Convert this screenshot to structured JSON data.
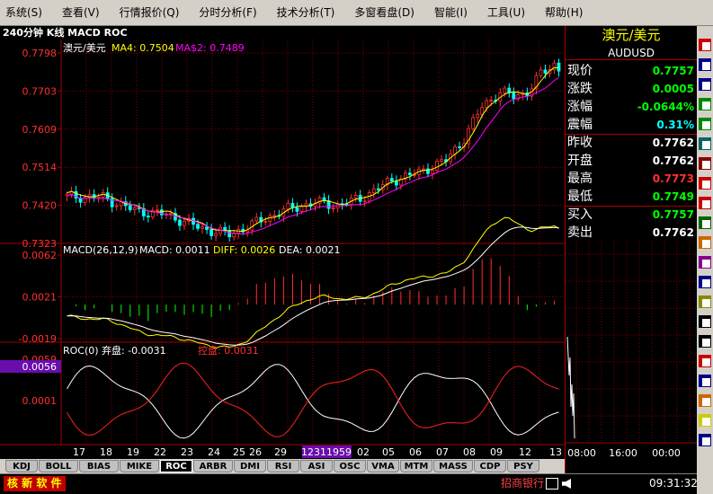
{
  "menu": [
    "系统(S)",
    "查看(V)",
    "行情报价(Q)",
    "分时分析(F)",
    "技术分析(T)",
    "多窗看盘(D)",
    "智能(I)",
    "工具(U)",
    "帮助(H)"
  ],
  "chart_title": "240分钟 K线 MACD ROC",
  "main_panel": {
    "symbol_label": "澳元/美元",
    "ma4_label": "MA4: 0.7504",
    "ma2_label": "MA$2: 0.7489",
    "y_ticks": [
      "0.7798",
      "0.7703",
      "0.7609",
      "0.7514",
      "0.7420",
      "0.7323"
    ]
  },
  "macd_panel": {
    "header": "MACD(26,12,9)",
    "macd_label": "MACD: 0.0011",
    "diff_label": "DIFF: 0.0026",
    "dea_label": "DEA: 0.0021",
    "y_ticks": [
      "0.0062",
      "0.0021",
      "-0.0019"
    ]
  },
  "roc_panel": {
    "header": "ROC(0)",
    "qi_label": "弃盘: -0.0031",
    "kong_label": "控盘: 0.0031",
    "y_ticks": [
      "0.0059",
      "0.0056",
      "0.0001"
    ]
  },
  "x_axis": [
    "17",
    "18",
    "19",
    "22",
    "23",
    "24",
    "25",
    "26",
    "29",
    "12311959",
    "02",
    "05",
    "06",
    "07",
    "08",
    "09",
    "12",
    "13"
  ],
  "tabs": [
    "KDJ",
    "BOLL",
    "BIAS",
    "MIKE",
    "ROC",
    "ARBR",
    "DMI",
    "RSI",
    "ASI",
    "OSC",
    "VMA",
    "MTM",
    "MASS",
    "CDP",
    "PSY"
  ],
  "active_tab": "ROC",
  "quote": {
    "name_cn": "澳元/美元",
    "code": "AUDUSD",
    "rows": [
      {
        "label": "现价",
        "value": "0.7757",
        "color": "#00ff00"
      },
      {
        "label": "涨跌",
        "value": "0.0005",
        "color": "#00ff00"
      },
      {
        "label": "涨幅",
        "value": "-0.0644%",
        "color": "#00ff00"
      },
      {
        "label": "震幅",
        "value": "0.31%",
        "color": "#00ffff"
      },
      {
        "label": "昨收",
        "value": "0.7762",
        "color": "#ffffff"
      },
      {
        "label": "开盘",
        "value": "0.7762",
        "color": "#ffffff"
      },
      {
        "label": "最高",
        "value": "0.7773",
        "color": "#ff3030"
      },
      {
        "label": "最低",
        "value": "0.7749",
        "color": "#00ff00"
      },
      {
        "label": "买入",
        "value": "0.7757",
        "color": "#00ff00"
      },
      {
        "label": "卖出",
        "value": "0.7762",
        "color": "#ffffff"
      }
    ]
  },
  "intraday_times": [
    "08:00",
    "16:00",
    "00:00"
  ],
  "status": {
    "left_text": "核 新 软 件",
    "broker": "招商银行",
    "clock": "09:31:32"
  },
  "colors": {
    "up": "#ff3030",
    "down": "#00ffff",
    "ma4": "#ffff00",
    "ma2": "#ff00ff",
    "grid": "#a00000"
  }
}
